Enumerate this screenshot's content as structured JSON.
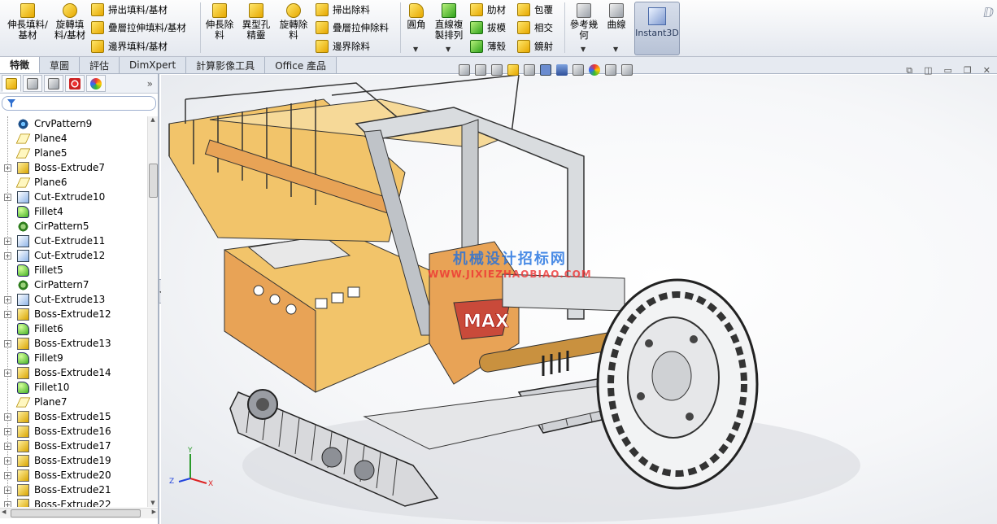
{
  "ribbon": {
    "extruded_boss": "伸長填料/基材",
    "revolved_boss": "旋轉填料/基材",
    "swept_boss": "掃出填料/基材",
    "lofted_boss": "疊層拉伸填料/基材",
    "boundary_boss": "邊界填料/基材",
    "extruded_cut": "伸長除料",
    "hole_wizard": "異型孔精靈",
    "revolved_cut": "旋轉除料",
    "swept_cut": "掃出除料",
    "lofted_cut": "疊層拉伸除料",
    "boundary_cut": "邊界除料",
    "fillet": "圓角",
    "linear_pattern": "直線複製排列",
    "rib": "肋材",
    "draft": "拔模",
    "shell": "薄殼",
    "wrap": "包覆",
    "intersect": "相交",
    "mirror": "鏡射",
    "reference_geometry": "參考幾何",
    "curves": "曲線",
    "instant3d": "Instant3D"
  },
  "tabs": [
    "特徵",
    "草圖",
    "評估",
    "DimXpert",
    "計算影像工具",
    "Office 產品"
  ],
  "active_tab": 0,
  "tree": [
    {
      "label": "CrvPattern9",
      "icon": "curve-pattern-icon",
      "expandable": false
    },
    {
      "label": "Plane4",
      "icon": "plane-icon",
      "expandable": false
    },
    {
      "label": "Plane5",
      "icon": "plane-icon",
      "expandable": false
    },
    {
      "label": "Boss-Extrude7",
      "icon": "boss-extrude-icon",
      "expandable": true
    },
    {
      "label": "Plane6",
      "icon": "plane-icon",
      "expandable": false
    },
    {
      "label": "Cut-Extrude10",
      "icon": "cut-extrude-icon",
      "expandable": true
    },
    {
      "label": "Fillet4",
      "icon": "fillet-icon",
      "expandable": false
    },
    {
      "label": "CirPattern5",
      "icon": "circular-pattern-icon",
      "expandable": false
    },
    {
      "label": "Cut-Extrude11",
      "icon": "cut-extrude-icon",
      "expandable": true
    },
    {
      "label": "Cut-Extrude12",
      "icon": "cut-extrude-icon",
      "expandable": true
    },
    {
      "label": "Fillet5",
      "icon": "fillet-icon",
      "expandable": false
    },
    {
      "label": "CirPattern7",
      "icon": "circular-pattern-icon",
      "expandable": false
    },
    {
      "label": "Cut-Extrude13",
      "icon": "cut-extrude-icon",
      "expandable": true
    },
    {
      "label": "Boss-Extrude12",
      "icon": "boss-extrude-icon",
      "expandable": true
    },
    {
      "label": "Fillet6",
      "icon": "fillet-icon",
      "expandable": false
    },
    {
      "label": "Boss-Extrude13",
      "icon": "boss-extrude-icon",
      "expandable": true
    },
    {
      "label": "Fillet9",
      "icon": "fillet-icon",
      "expandable": false
    },
    {
      "label": "Boss-Extrude14",
      "icon": "boss-extrude-icon",
      "expandable": true
    },
    {
      "label": "Fillet10",
      "icon": "fillet-icon",
      "expandable": false
    },
    {
      "label": "Plane7",
      "icon": "plane-icon",
      "expandable": false
    },
    {
      "label": "Boss-Extrude15",
      "icon": "boss-extrude-icon",
      "expandable": true
    },
    {
      "label": "Boss-Extrude16",
      "icon": "boss-extrude-icon",
      "expandable": true
    },
    {
      "label": "Boss-Extrude17",
      "icon": "boss-extrude-icon",
      "expandable": true
    },
    {
      "label": "Boss-Extrude19",
      "icon": "boss-extrude-icon",
      "expandable": true
    },
    {
      "label": "Boss-Extrude20",
      "icon": "boss-extrude-icon",
      "expandable": true
    },
    {
      "label": "Boss-Extrude21",
      "icon": "boss-extrude-icon",
      "expandable": true
    },
    {
      "label": "Boss-Extrude22",
      "icon": "boss-extrude-icon",
      "expandable": true
    }
  ],
  "viewport": {
    "watermark_line1": "机械设计招标网",
    "watermark_line2": "WWW.JIXIEZHAOBIAO.COM",
    "model_logo": "MAX",
    "triad": {
      "x": "X",
      "y": "Y",
      "z": "Z"
    }
  },
  "colors": {
    "model_tan": "#f2c46a",
    "model_orange": "#e8a356",
    "model_gray": "#bfc3c8",
    "accent": "#1d6fe0"
  }
}
